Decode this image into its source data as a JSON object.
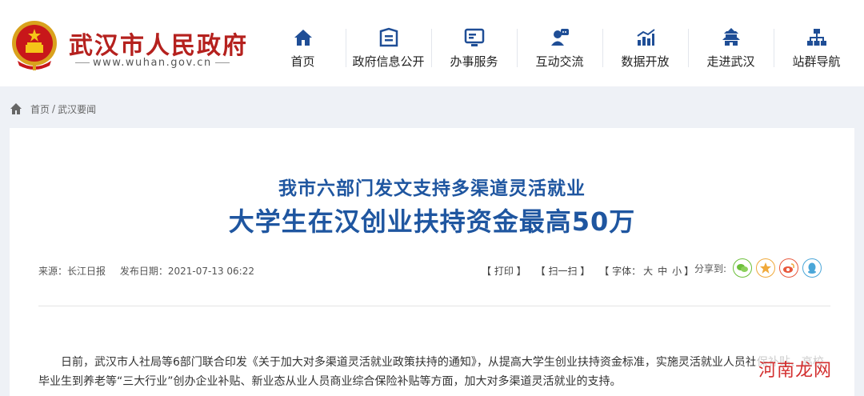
{
  "header": {
    "site_name": "武汉市人民政府",
    "site_url": "www.wuhan.gov.cn",
    "brand_color": "#b5211e"
  },
  "nav": {
    "items": [
      {
        "label": "首页",
        "icon": "home-icon"
      },
      {
        "label": "政府信息公开",
        "icon": "info-board-icon"
      },
      {
        "label": "办事服务",
        "icon": "monitor-icon"
      },
      {
        "label": "互动交流",
        "icon": "chat-person-icon"
      },
      {
        "label": "数据开放",
        "icon": "chart-icon"
      },
      {
        "label": "走进武汉",
        "icon": "pavilion-icon"
      },
      {
        "label": "站群导航",
        "icon": "sitemap-icon"
      }
    ],
    "icon_color": "#1f4e96"
  },
  "breadcrumb": {
    "home": "首页",
    "separator": "/",
    "current": "武汉要闻"
  },
  "article": {
    "title_line1": "我市六部门发文支持多渠道灵活就业",
    "title_line2": "大学生在汉创业扶持资金最高50万",
    "source": "来源：长江日报",
    "date": "发布日期：2021-07-13 06:22",
    "tools": {
      "print": "【 打印 】",
      "scan": "【 扫一扫 】",
      "font_prefix": "【 字体：",
      "font_large": "大",
      "font_medium": "中",
      "font_small": "小",
      "font_suffix": "】"
    },
    "share_label": "分享到:",
    "share_buttons": [
      {
        "name": "wechat-icon",
        "color": "#6cbf3a"
      },
      {
        "name": "star-icon",
        "color": "#f0a93a"
      },
      {
        "name": "weibo-icon",
        "color": "#e8583c"
      },
      {
        "name": "qq-icon",
        "color": "#4aa6d8"
      }
    ],
    "paragraph": "日前，武汉市人社局等6部门联合印发《关于加大对多渠道灵活就业政策扶持的通知》，从提高大学生创业扶持资金标准，实施灵活就业人员社保补贴、高校毕业生到养老等“三大行业”创办企业补贴、新业态从业人员商业综合保险补贴等方面，加大对多渠道灵活就业的支持。",
    "title_color": "#1f56a0"
  },
  "watermark": "河南龙网"
}
